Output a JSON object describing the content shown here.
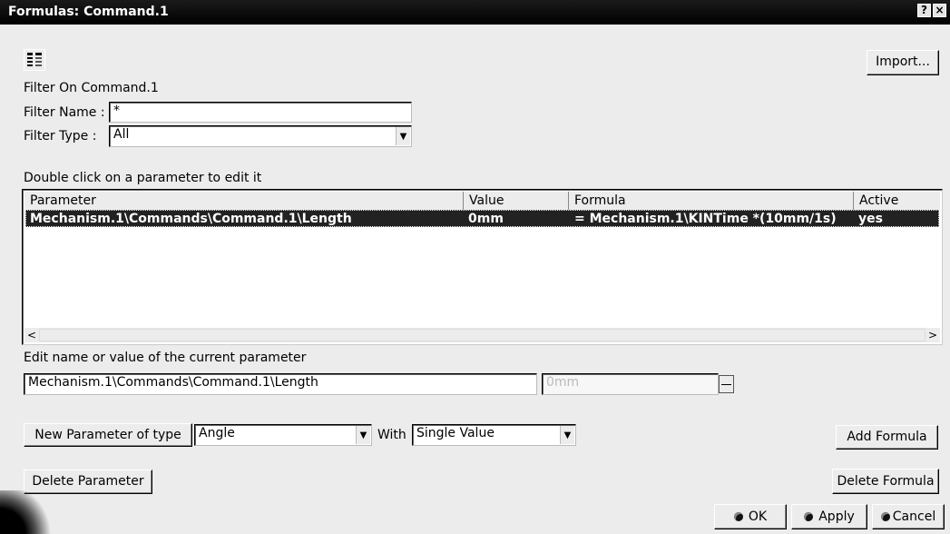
{
  "window": {
    "title": "Formulas: Command.1",
    "help_button": "?",
    "close_button": "×"
  },
  "toolbar": {
    "import_label": "Import...",
    "icon": "formula-list-icon"
  },
  "filter": {
    "on_label": "Filter On Command.1",
    "name_label": "Filter Name :",
    "name_value": "*",
    "type_label": "Filter Type :",
    "type_value": "All"
  },
  "table": {
    "hint": "Double click on a parameter to edit it",
    "columns": [
      "Parameter",
      "Value",
      "Formula",
      "Active"
    ],
    "rows": [
      {
        "parameter": "Mechanism.1\\Commands\\Command.1\\Length",
        "value": "0mm",
        "formula": "= Mechanism.1\\KINTime *(10mm/1s)",
        "active": "yes"
      }
    ]
  },
  "edit": {
    "label": "Edit name or value of the current parameter",
    "name_value": "Mechanism.1\\Commands\\Command.1\\Length",
    "value_placeholder": "0mm"
  },
  "new_parameter": {
    "button_label": "New Parameter of type",
    "type_value": "Angle",
    "with_label": "With",
    "with_value": "Single Value"
  },
  "actions": {
    "add_formula": "Add Formula",
    "delete_parameter": "Delete Parameter",
    "delete_formula": "Delete Formula",
    "ok": "OK",
    "apply": "Apply",
    "cancel": "Cancel"
  }
}
